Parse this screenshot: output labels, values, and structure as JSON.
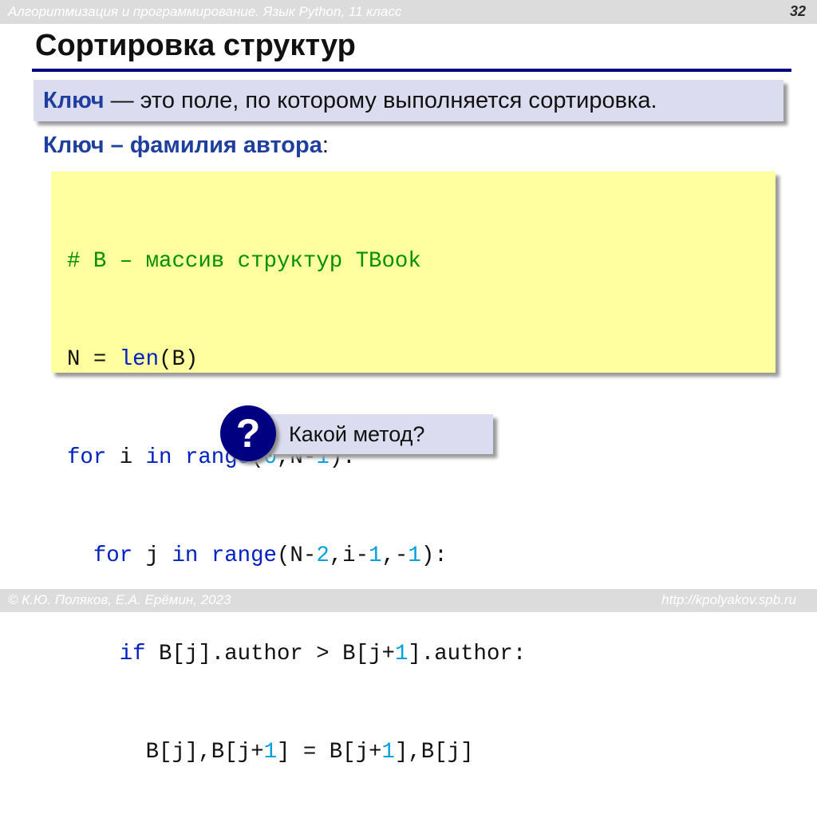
{
  "header": {
    "course": "Алгоритмизация и программирование. Язык Python, 11 класс",
    "slide_number": "32"
  },
  "title": "Сортировка структур",
  "definition": {
    "term": "Ключ",
    "text": " — это поле, по которому выполняется сортировка."
  },
  "key_line": {
    "text": "Ключ – фамилия автора",
    "colon": ":"
  },
  "code": {
    "line1_comment": "# B – массив структур TBook",
    "line2_a": "N = ",
    "line2_fn": "len",
    "line2_b": "(B)",
    "line3_for": "for",
    "line3_a": " i ",
    "line3_in": "in",
    "line3_sp": " ",
    "line3_range": "range",
    "line3_b": "(",
    "line3_n0": "0",
    "line3_c": ",N-",
    "line3_n1": "1",
    "line3_d": "):",
    "line4_indent": "  ",
    "line4_for": "for",
    "line4_a": " j ",
    "line4_in": "in",
    "line4_sp": " ",
    "line4_range": "range",
    "line4_b": "(N-",
    "line4_n2": "2",
    "line4_c": ",i-",
    "line4_n1a": "1",
    "line4_d": ",-",
    "line4_n1b": "1",
    "line4_e": "):",
    "line5_indent": "    ",
    "line5_if": "if",
    "line5_a": " B[j].author > B[j+",
    "line5_n1": "1",
    "line5_b": "].author:",
    "line6_indent": "      ",
    "line6_a": "B[j],B[j+",
    "line6_n1a": "1",
    "line6_b": "] = B[j+",
    "line6_n1b": "1",
    "line6_c": "],B[j]"
  },
  "question": {
    "icon_glyph": "?",
    "text": "Какой метод?"
  },
  "footer": {
    "copyright": "© К.Ю. Поляков, Е.А. Ерёмин, 2023",
    "url": "http://kpolyakov.spb.ru"
  },
  "colors": {
    "accent_navy": "#000080",
    "keyword_blue": "#0020c0",
    "comment_green": "#009000",
    "number_cyan": "#00a0e0",
    "code_bg": "#ffff9f",
    "box_bg": "#dcdcf0"
  }
}
